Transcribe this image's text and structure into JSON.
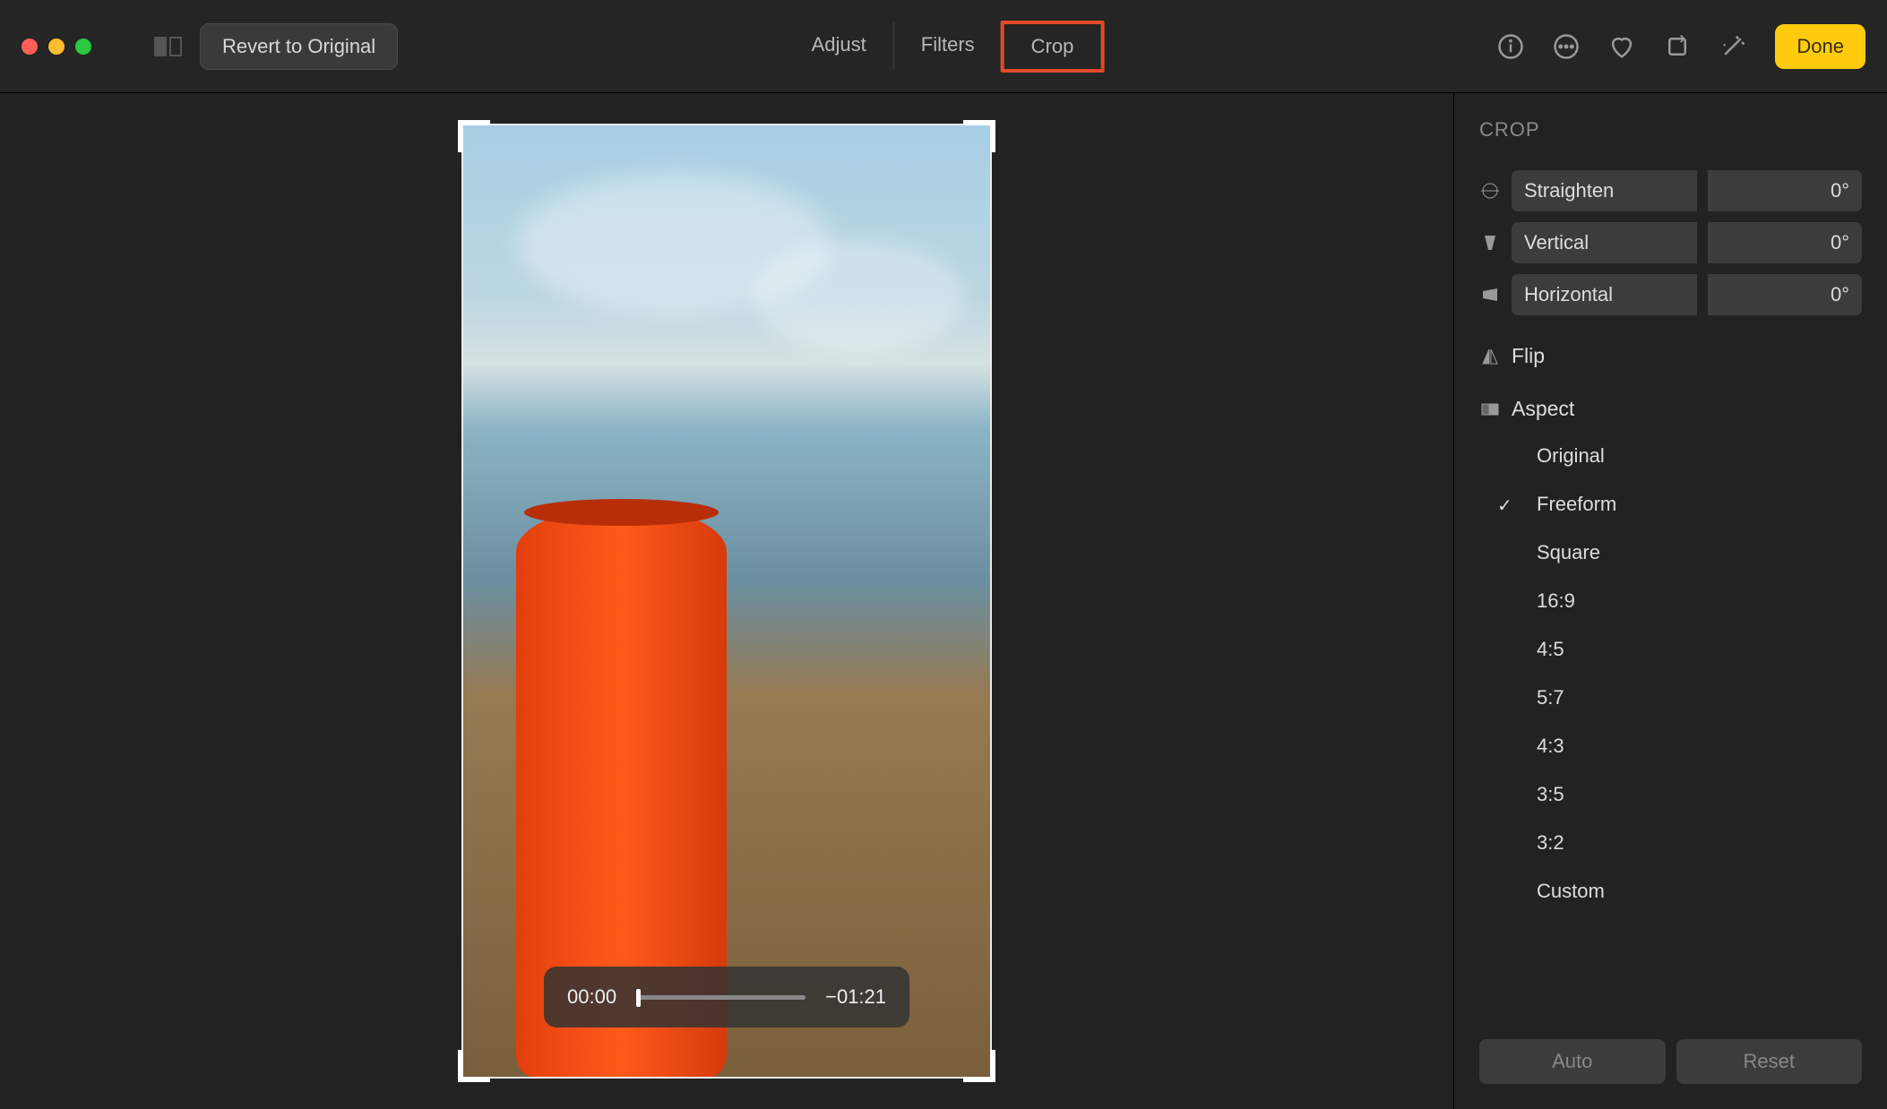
{
  "toolbar": {
    "revert_label": "Revert to Original",
    "tabs": {
      "adjust": "Adjust",
      "filters": "Filters",
      "crop": "Crop"
    },
    "active_tab": "crop",
    "done_label": "Done"
  },
  "video": {
    "current_time": "00:00",
    "remaining_time": "−01:21"
  },
  "sidebar": {
    "title": "CROP",
    "straighten": {
      "label": "Straighten",
      "value": "0°"
    },
    "vertical": {
      "label": "Vertical",
      "value": "0°"
    },
    "horizontal": {
      "label": "Horizontal",
      "value": "0°"
    },
    "flip_label": "Flip",
    "aspect_label": "Aspect",
    "aspect_options": {
      "original": "Original",
      "freeform": "Freeform",
      "square": "Square",
      "r16_9": "16:9",
      "r4_5": "4:5",
      "r5_7": "5:7",
      "r4_3": "4:3",
      "r3_5": "3:5",
      "r3_2": "3:2",
      "custom": "Custom"
    },
    "selected_aspect": "freeform",
    "auto_label": "Auto",
    "reset_label": "Reset"
  }
}
